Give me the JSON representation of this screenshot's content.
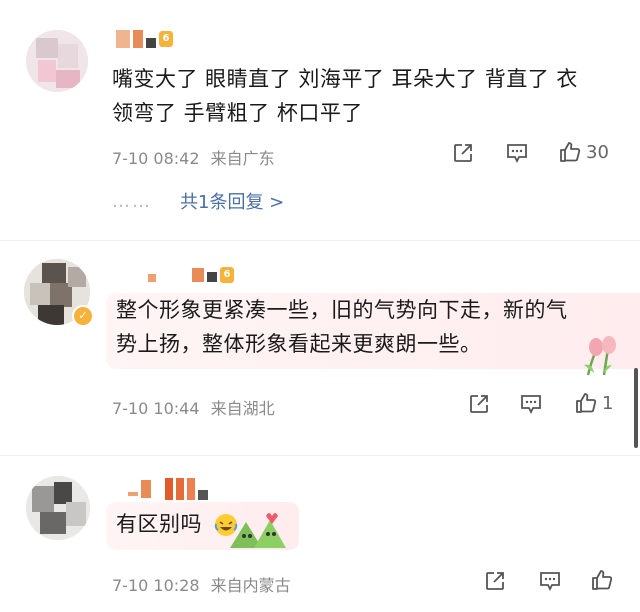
{
  "comments": [
    {
      "text_line1": "嘴变大了 眼睛直了 刘海平了 耳朵大了 背直了 衣",
      "text_line2": "领弯了 手臂粗了 杯口平了",
      "time": "7-10 08:42",
      "location": "来自广东",
      "like_count": "30",
      "level": "6"
    },
    {
      "text_line1": "整个形象更紧凑一些，旧的气势向下走，新的气",
      "text_line2": "势上扬，整体形象看起来更爽朗一些。",
      "time": "7-10 10:44",
      "location": "来自湖北",
      "like_count": "1",
      "level": "6"
    },
    {
      "text_line1": "有区别吗",
      "time": "7-10 10:28",
      "location": "来自内蒙古",
      "like_count": ""
    }
  ],
  "replies_link": "共1条回复 >",
  "replies_dots": "……",
  "icons": {
    "share": "share-icon",
    "comment": "comment-icon",
    "like": "thumbs-up-icon"
  },
  "colors": {
    "link_blue": "#4a6fa5",
    "meta_gray": "#8a8a8a",
    "level_badge": "#f7b23b"
  }
}
